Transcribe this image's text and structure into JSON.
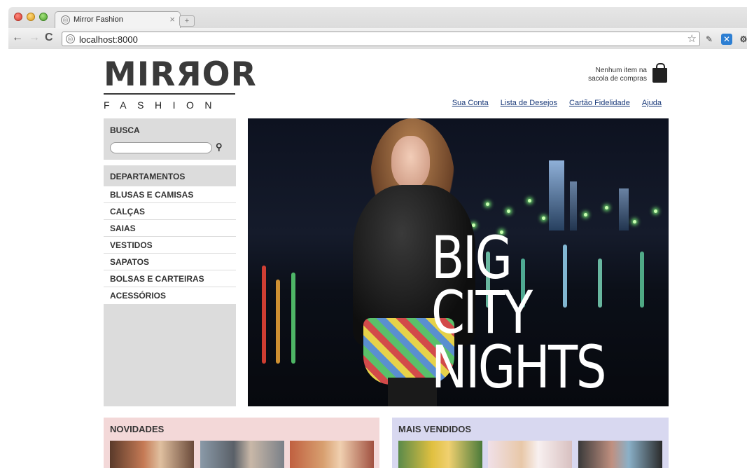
{
  "browser": {
    "tab_title": "Mirror Fashion",
    "tab_close": "×",
    "new_tab": "+",
    "back": "←",
    "forward": "→",
    "reload": "C",
    "url": "localhost:8000",
    "bookmark_star": "☆"
  },
  "logo": {
    "main": "MIRЯOR",
    "sub": "FASHION"
  },
  "cart": {
    "text_line1": "Nenhum item na",
    "text_line2": "sacola de compras"
  },
  "top_links": [
    "Sua Conta",
    "Lista de Desejos",
    "Cartão Fidelidade",
    "Ajuda"
  ],
  "search": {
    "title": "BUSCA",
    "value": "",
    "button": "🔍"
  },
  "departments": {
    "title": "DEPARTAMENTOS",
    "items": [
      "BLUSAS E CAMISAS",
      "CALÇAS",
      "SAIAS",
      "VESTIDOS",
      "SAPATOS",
      "BOLSAS E CARTEIRAS",
      "ACESSÓRIOS"
    ]
  },
  "hero": {
    "line1": "BIG",
    "line2": "CITY",
    "line3": "NIGHTS"
  },
  "panels": {
    "novidades": "NOVIDADES",
    "mais_vendidos": "MAIS VENDIDOS"
  },
  "colors": {
    "novidades_bg": "#f3d8d8",
    "mais_vendidos_bg": "#d8d8f0",
    "sidebar_bg": "#dcdcdc",
    "link": "#1a3a7a"
  }
}
